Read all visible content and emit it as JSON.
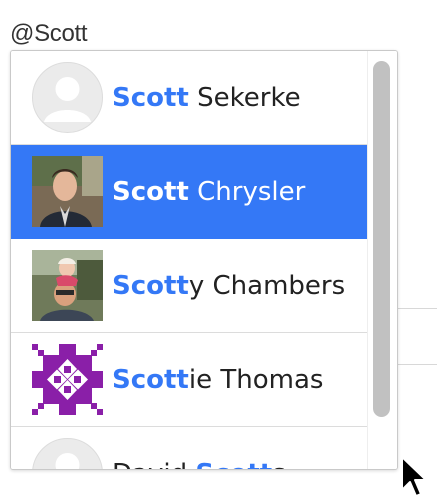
{
  "compose": {
    "query_text": "@Scott"
  },
  "mention_dropdown": {
    "accent_color": "#3478f6",
    "items": [
      {
        "highlight": "Scott",
        "rest_before": "",
        "rest": " Sekerke",
        "avatar": "default-avatar-icon",
        "selected": false
      },
      {
        "highlight": "Scott",
        "rest_before": "",
        "rest": " Chrysler",
        "avatar": "photo-avatar",
        "selected": true
      },
      {
        "highlight": "Scott",
        "rest_before": "",
        "rest": "y Chambers",
        "avatar": "photo-avatar",
        "selected": false
      },
      {
        "highlight": "Scott",
        "rest_before": "",
        "rest": "ie Thomas",
        "avatar": "identicon-avatar",
        "selected": false
      },
      {
        "highlight": "Scott",
        "rest_before": "David ",
        "rest": "s",
        "avatar": "default-avatar-icon",
        "selected": false
      }
    ]
  },
  "pointer": "mouse-cursor-icon"
}
